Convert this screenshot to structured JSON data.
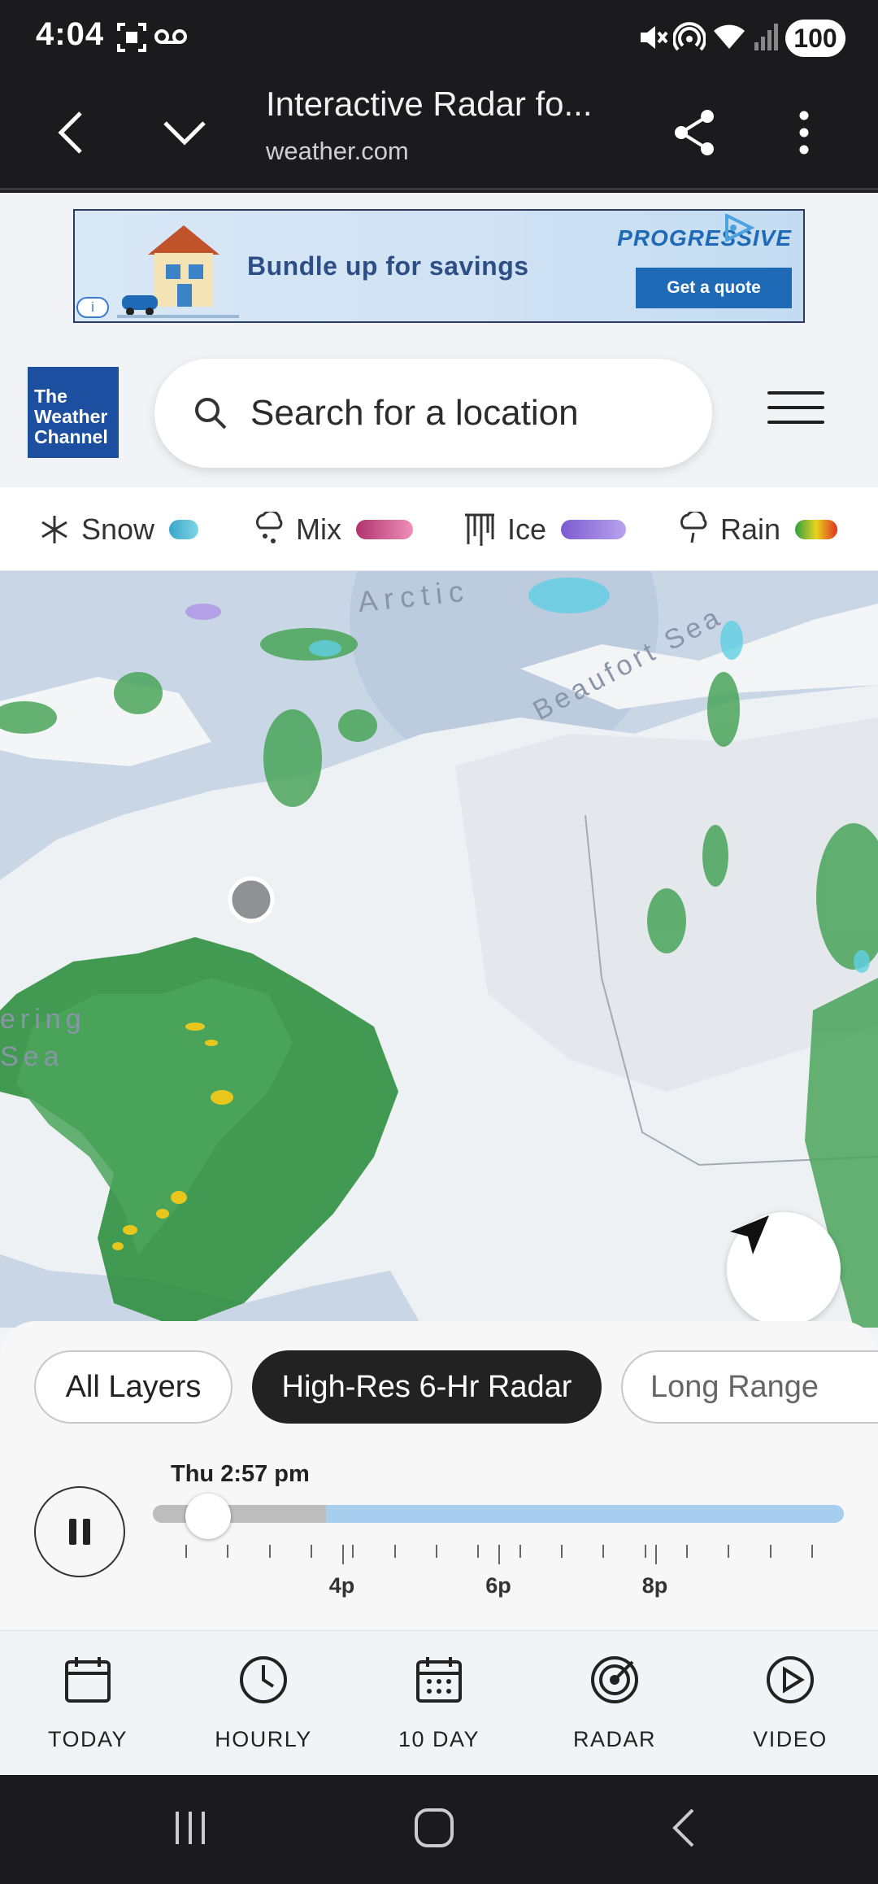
{
  "status_bar": {
    "time": "4:04",
    "battery": "100"
  },
  "browser": {
    "title": "Interactive Radar fo...",
    "url": "weather.com"
  },
  "ad": {
    "headline": "Bundle up for savings",
    "brand": "PROGRESSIVE",
    "cta": "Get a quote",
    "info_badge": "i"
  },
  "header": {
    "logo": [
      "The",
      "Weather",
      "Channel"
    ],
    "search_placeholder": "Search for a location"
  },
  "legend": [
    {
      "label": "Snow",
      "icon": "snowflake-icon",
      "colors": [
        "#3aa6c8",
        "#7fd6e6"
      ]
    },
    {
      "label": "Mix",
      "icon": "mix-precip-icon",
      "colors": [
        "#b1336e",
        "#ef8fb7"
      ]
    },
    {
      "label": "Ice",
      "icon": "ice-icon",
      "colors": [
        "#7c5bd0",
        "#b8a3ec"
      ]
    },
    {
      "label": "Rain",
      "icon": "rain-icon",
      "colors": [
        "#2ea043",
        "#e8d21f",
        "#e0301e"
      ]
    }
  ],
  "map": {
    "labels": {
      "arctic": "Arctic",
      "beaufort": "Beaufort Sea",
      "bering_1": "ering",
      "bering_2": "Sea"
    }
  },
  "layers": {
    "items": [
      "All Layers",
      "High-Res 6-Hr Radar",
      "Long Range"
    ],
    "active": "High-Res 6-Hr Radar"
  },
  "timeline": {
    "current_time": "Thu 2:57 pm",
    "progress_fraction": 0.08,
    "past_fraction": 0.25,
    "ticks": [
      "4p",
      "6p",
      "8p"
    ]
  },
  "tabs": [
    {
      "label": "TODAY",
      "icon": "calendar-icon"
    },
    {
      "label": "HOURLY",
      "icon": "clock-icon"
    },
    {
      "label": "10 DAY",
      "icon": "calendar-grid-icon"
    },
    {
      "label": "RADAR",
      "icon": "radar-icon"
    },
    {
      "label": "VIDEO",
      "icon": "play-circle-icon"
    }
  ]
}
